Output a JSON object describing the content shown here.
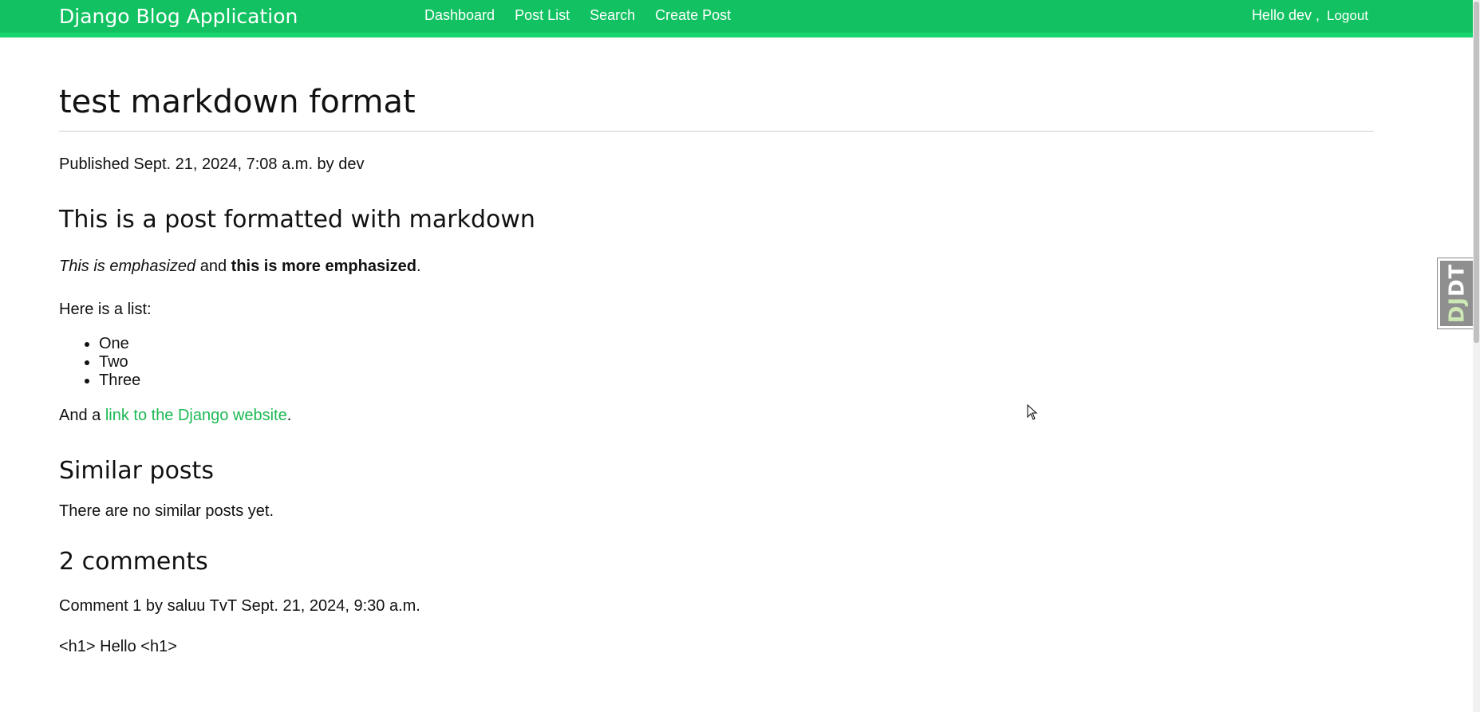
{
  "header": {
    "brand": "Django Blog Application",
    "nav": [
      {
        "label": "Dashboard"
      },
      {
        "label": "Post List"
      },
      {
        "label": "Search"
      },
      {
        "label": "Create Post"
      }
    ],
    "greeting": "Hello dev ,",
    "logout": "Logout"
  },
  "post": {
    "title": "test markdown format",
    "meta": "Published Sept. 21, 2024, 7:08 a.m. by dev",
    "heading": "This is a post formatted with markdown",
    "emph_italic": "This is emphasized",
    "emph_and": " and ",
    "emph_bold": "this is more emphasized",
    "emph_end": ".",
    "list_intro": "Here is a list:",
    "list_items": [
      "One",
      "Two",
      "Three"
    ],
    "link_prefix": "And a ",
    "link_text": "link to the Django website",
    "link_suffix": "."
  },
  "similar": {
    "heading": "Similar posts",
    "empty_text": "There are no similar posts yet."
  },
  "comments": {
    "heading": "2 comments",
    "items": [
      {
        "meta": "Comment 1 by saluu TvT Sept. 21, 2024, 9:30 a.m.",
        "body": "<h1> Hello <h1>"
      }
    ]
  },
  "debug_toolbar": {
    "label_dj": "DJ",
    "label_dt": "DT"
  },
  "colors": {
    "accent": "#12c262",
    "link": "#1db954"
  }
}
